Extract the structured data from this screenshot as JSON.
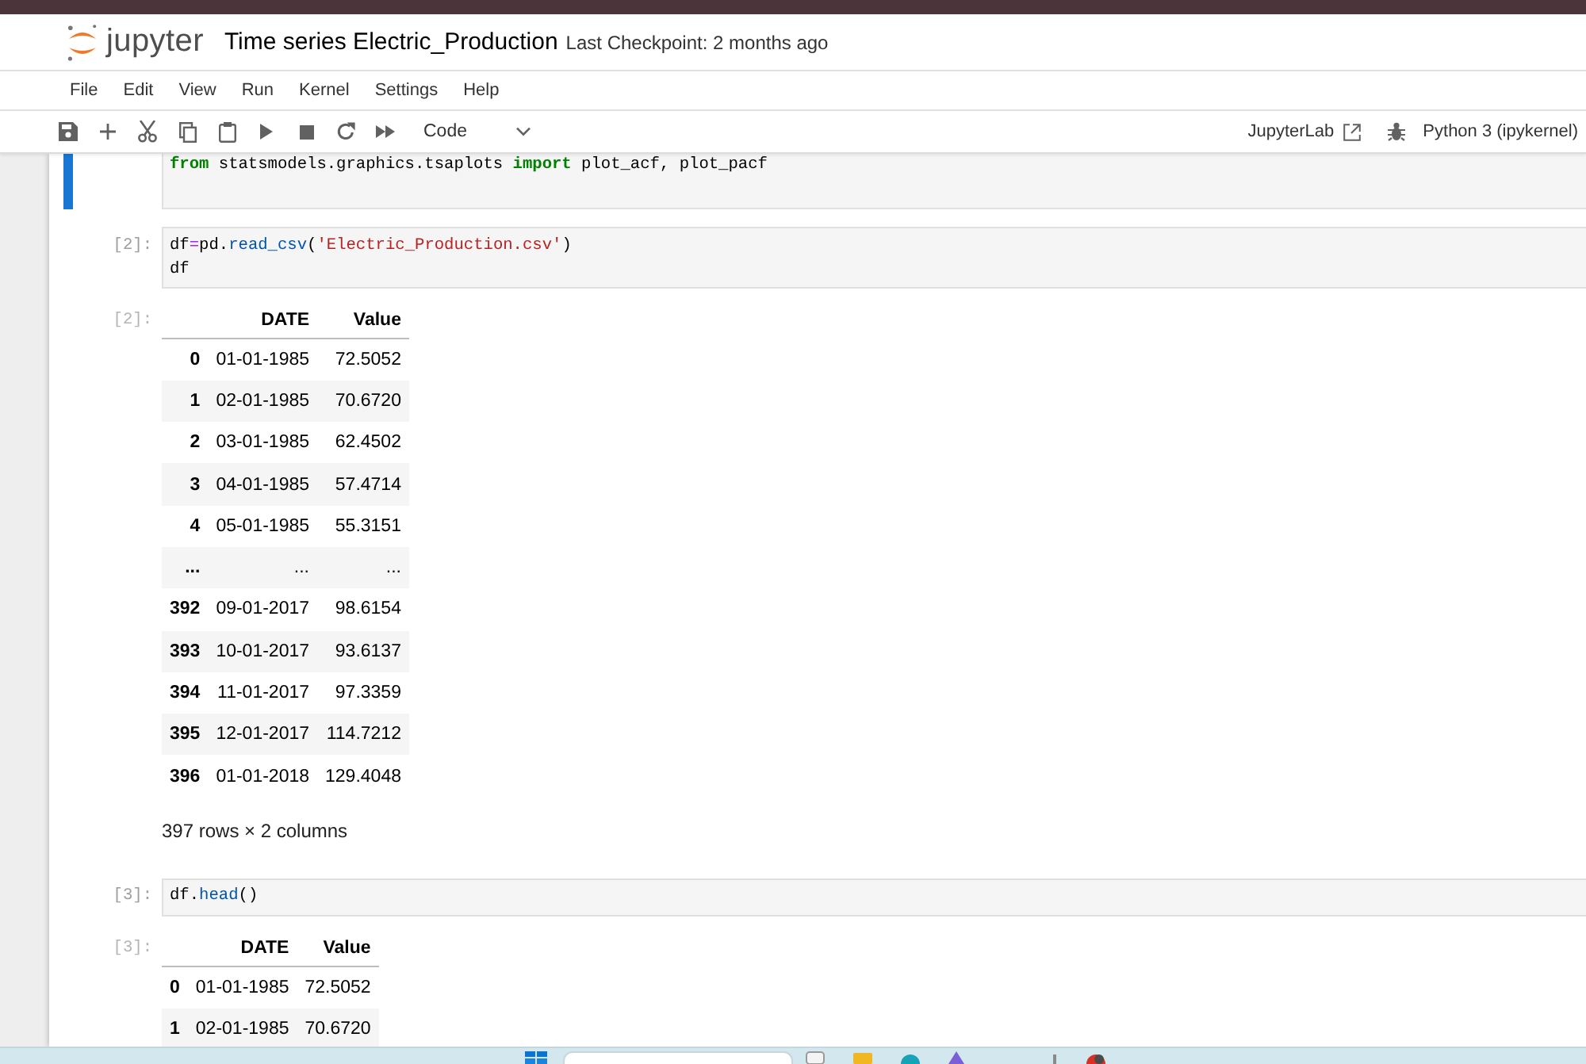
{
  "header": {
    "logo": "jupyter",
    "title": "Time series Electric_Production",
    "checkpoint": "Last Checkpoint: 2 months ago"
  },
  "menu_bar": [
    "File",
    "Edit",
    "View",
    "Run",
    "Kernel",
    "Settings",
    "Help"
  ],
  "toolbar": {
    "cell_type": "Code",
    "lab_link": "JupyterLab",
    "kernel": "Python 3 (ipykernel)"
  },
  "cells": [
    {
      "active": true,
      "source": [
        [
          {
            "text": "from",
            "kind": "keyword"
          },
          {
            "text": " statsmodels.graphics.tsaplots ",
            "kind": "plain"
          },
          {
            "text": "import",
            "kind": "keyword"
          },
          {
            "text": " plot_acf, plot_pacf",
            "kind": "plain"
          }
        ]
      ]
    },
    {
      "active": false,
      "prompt": "[2]:",
      "source": [
        [
          {
            "text": "df",
            "kind": "plain"
          },
          {
            "text": "=",
            "kind": "operator"
          },
          {
            "text": "pd.",
            "kind": "plain"
          },
          {
            "text": "read_csv",
            "kind": "function"
          },
          {
            "text": "(",
            "kind": "plain"
          },
          {
            "text": "'Electric_Production.csv'",
            "kind": "string"
          },
          {
            "text": ")",
            "kind": "plain"
          }
        ],
        [
          {
            "text": "df",
            "kind": "plain"
          }
        ]
      ],
      "output": {
        "prompt": "[2]:",
        "columns": [
          "DATE",
          "Value"
        ],
        "rows": [
          {
            "index": "0",
            "values": [
              "01-01-1985",
              "72.5052"
            ]
          },
          {
            "index": "1",
            "values": [
              "02-01-1985",
              "70.6720"
            ]
          },
          {
            "index": "2",
            "values": [
              "03-01-1985",
              "62.4502"
            ]
          },
          {
            "index": "3",
            "values": [
              "04-01-1985",
              "57.4714"
            ]
          },
          {
            "index": "4",
            "values": [
              "05-01-1985",
              "55.3151"
            ]
          },
          {
            "index": "...",
            "values": [
              "...",
              "..."
            ]
          },
          {
            "index": "392",
            "values": [
              "09-01-2017",
              "98.6154"
            ]
          },
          {
            "index": "393",
            "values": [
              "10-01-2017",
              "93.6137"
            ]
          },
          {
            "index": "394",
            "values": [
              "11-01-2017",
              "97.3359"
            ]
          },
          {
            "index": "395",
            "values": [
              "12-01-2017",
              "114.7212"
            ]
          },
          {
            "index": "396",
            "values": [
              "01-01-2018",
              "129.4048"
            ]
          }
        ],
        "summary": "397 rows × 2 columns"
      }
    },
    {
      "active": false,
      "prompt": "[3]:",
      "source": [
        [
          {
            "text": "df.",
            "kind": "plain"
          },
          {
            "text": "head",
            "kind": "function"
          },
          {
            "text": "()",
            "kind": "plain"
          }
        ]
      ],
      "output": {
        "prompt": "[3]:",
        "columns": [
          "DATE",
          "Value"
        ],
        "rows": [
          {
            "index": "0",
            "values": [
              "01-01-1985",
              "72.5052"
            ]
          },
          {
            "index": "1",
            "values": [
              "02-01-1985",
              "70.6720"
            ]
          }
        ]
      }
    }
  ]
}
